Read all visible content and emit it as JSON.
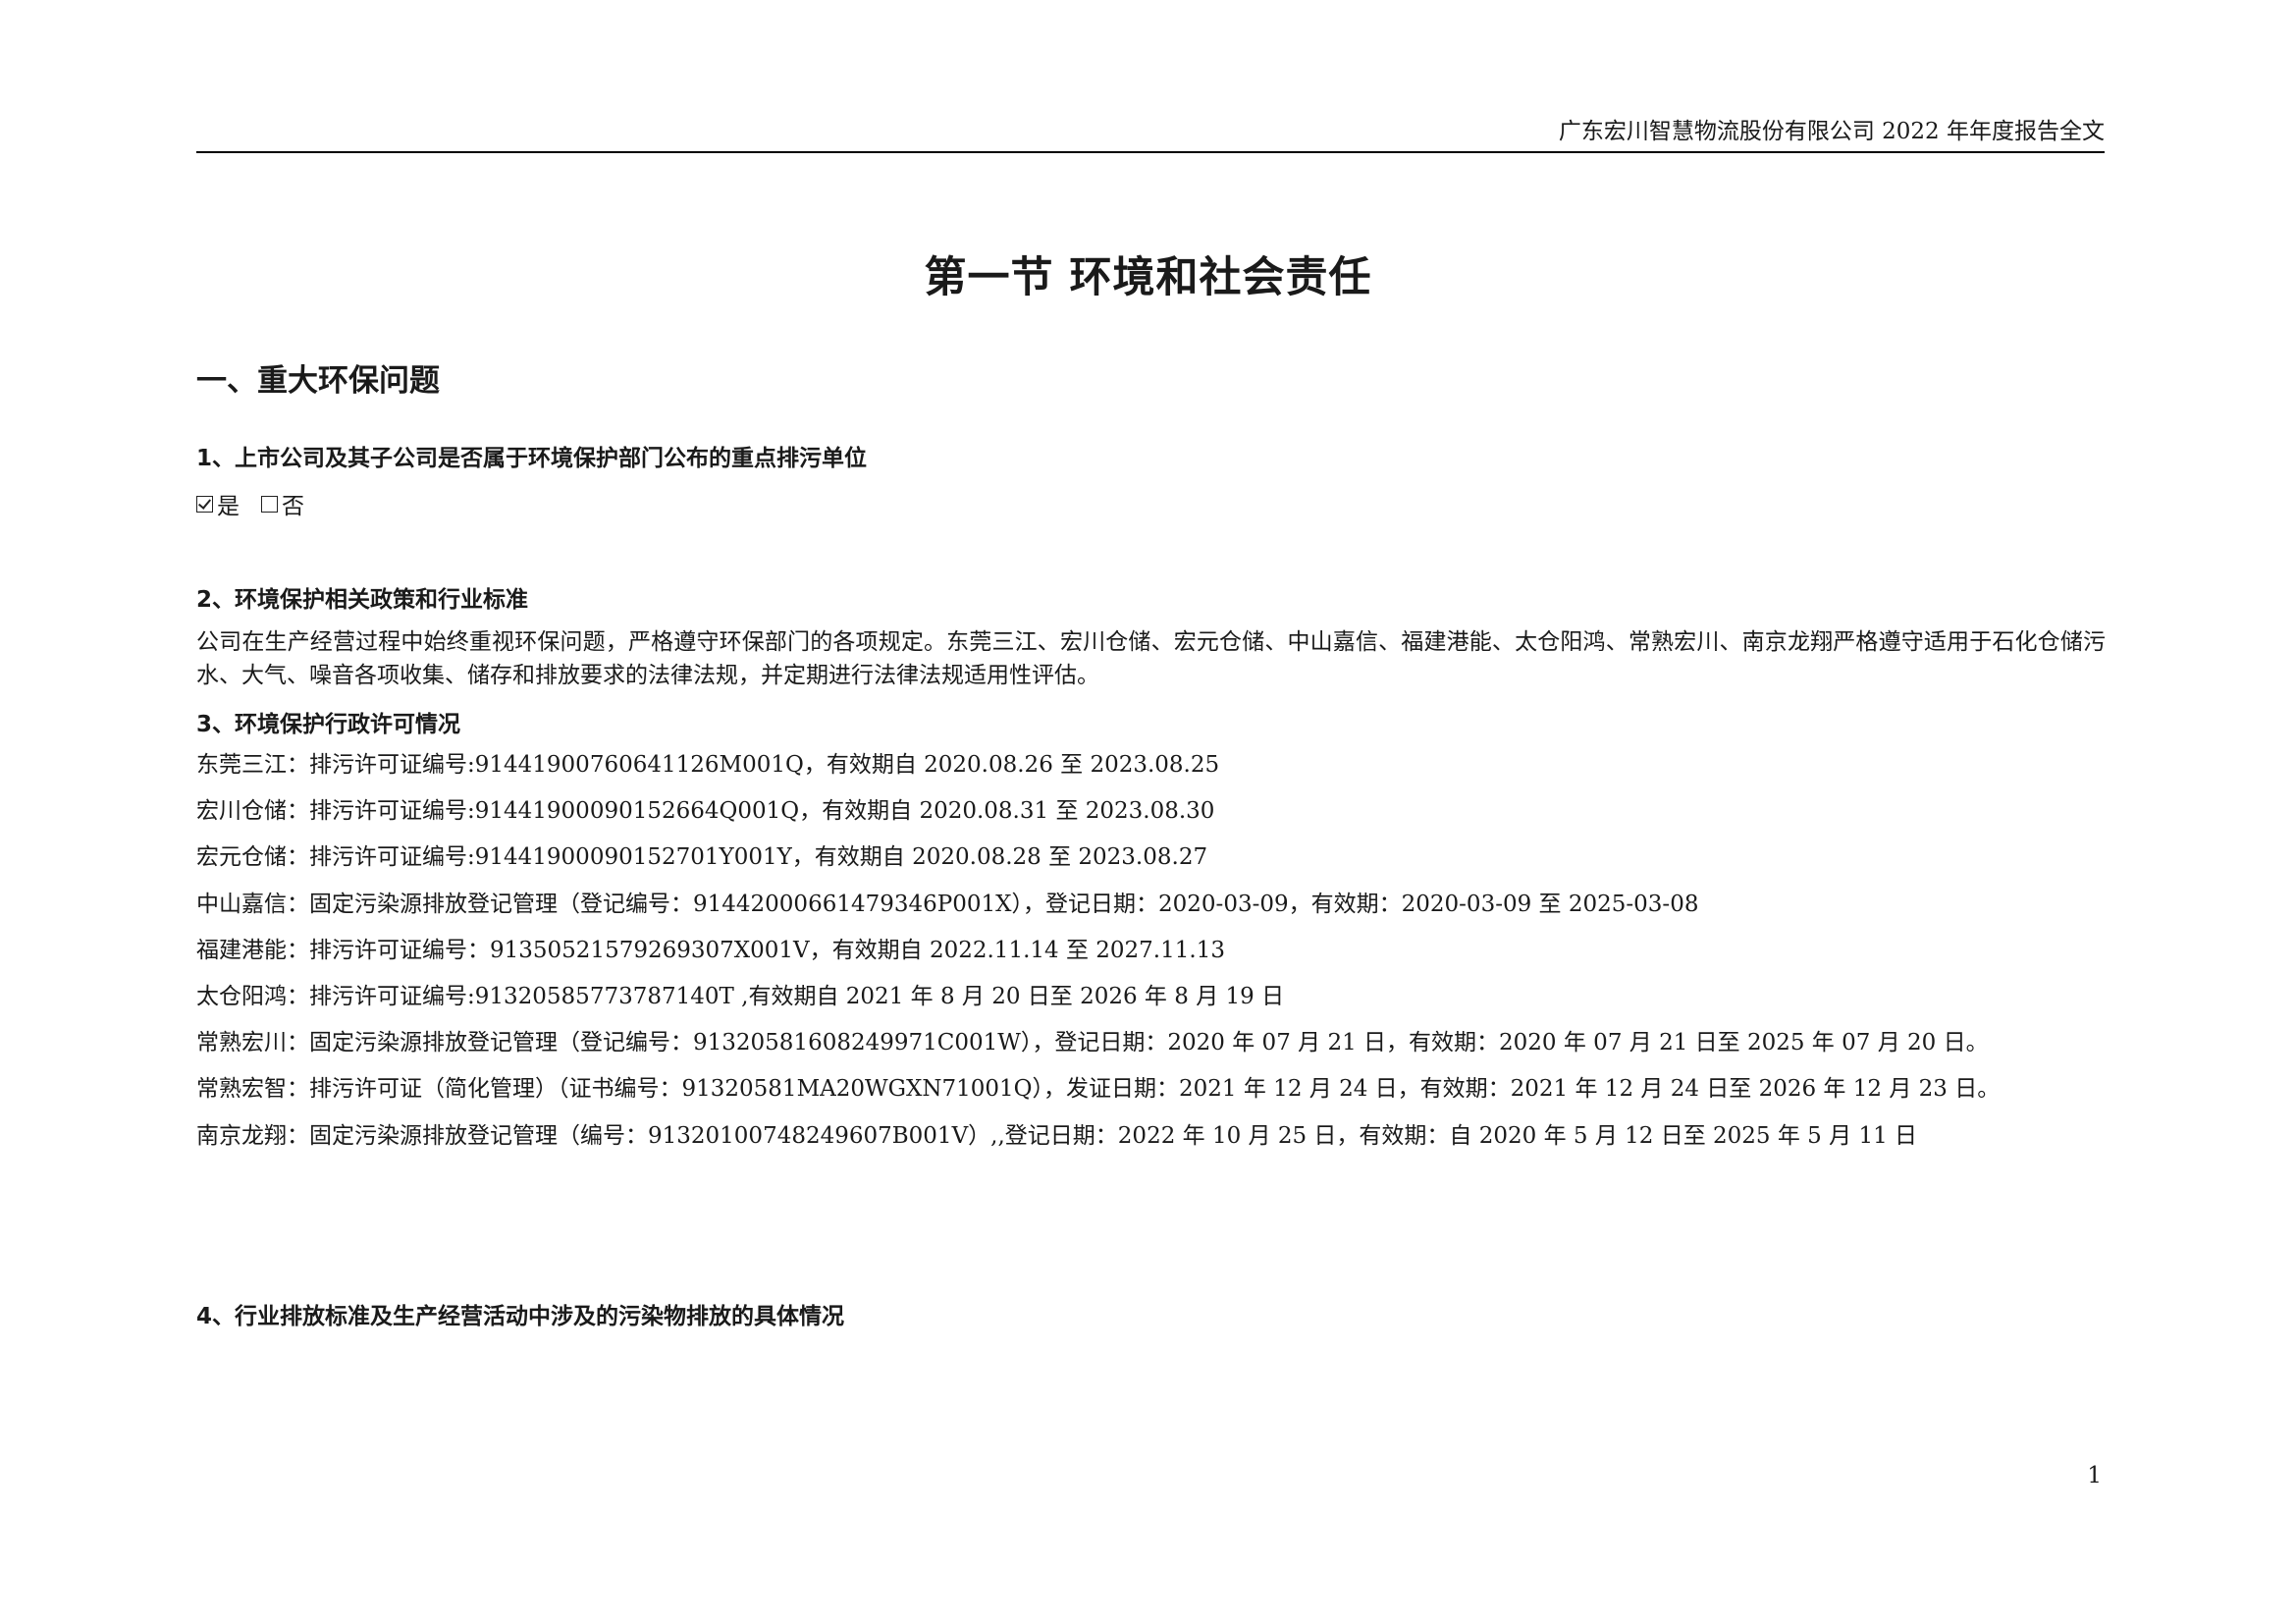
{
  "header": {
    "text": "广东宏川智慧物流股份有限公司 2022 年年度报告全文"
  },
  "section_title": "第一节  环境和社会责任",
  "part1": {
    "heading": "一、重大环保问题",
    "q1": {
      "heading": "1、上市公司及其子公司是否属于环境保护部门公布的重点排污单位",
      "options": [
        {
          "label": "是",
          "checked": true
        },
        {
          "label": "否",
          "checked": false
        }
      ]
    },
    "q2": {
      "heading": "2、环境保护相关政策和行业标准",
      "paragraph": "公司在生产经营过程中始终重视环保问题，严格遵守环保部门的各项规定。东莞三江、宏川仓储、宏元仓储、中山嘉信、福建港能、太仓阳鸿、常熟宏川、南京龙翔严格遵守适用于石化仓储污水、大气、噪音各项收集、储存和排放要求的法律法规，并定期进行法律法规适用性评估。"
    },
    "q3": {
      "heading": "3、环境保护行政许可情况",
      "permits": [
        "东莞三江：排污许可证编号:91441900760641126M001Q，有效期自 2020.08.26 至 2023.08.25",
        "宏川仓储：排污许可证编号:9144190009015266​4Q001Q，有效期自 2020.08.31 至 2023.08.30",
        "宏元仓储：排污许可证编号:91441900090152701Y001Y，有效期自 2020.08.28 至 2023.08.27",
        "中山嘉信：固定污染源排放登记管理（登记编号：91442000661479346P001X），登记日期：2020-03-09，有效期：2020-03-09 至 2025-03-08",
        "福建港能：排污许可证编号：91350521579269307X001V，有效期自 2022.11.14 至 2027.11.13",
        "太仓阳鸿：排污许可证编号:91320585773787140T ,有效期自 2021 年 8 月 20 日至 2026 年 8 月 19 日",
        "常熟宏川：固定污染源排放登记管理（登记编号：91320581608249971C001W），登记日期：2020 年 07 月 21 日，有效期：2020 年 07 月 21 日至 2025 年 07 月 20 日。",
        "常熟宏智：排污许可证（简化管理）（证书编号：91320581MA20WGXN71001Q），发证日期：2021 年 12 月 24 日，有效期：2021 年 12 月 24 日至 2026 年 12 月 23 日。",
        "南京龙翔：固定污染源排放登记管理（编号：91320100748249607B001V）,,登记日期：2022 年 10 月 25 日，有效期：自 2020 年 5 月 12 日至 2025 年 5 月 11 日"
      ]
    },
    "q4": {
      "heading": "4、行业排放标准及生产经营活动中涉及的污染物排放的具体情况"
    }
  },
  "page_number": "1"
}
